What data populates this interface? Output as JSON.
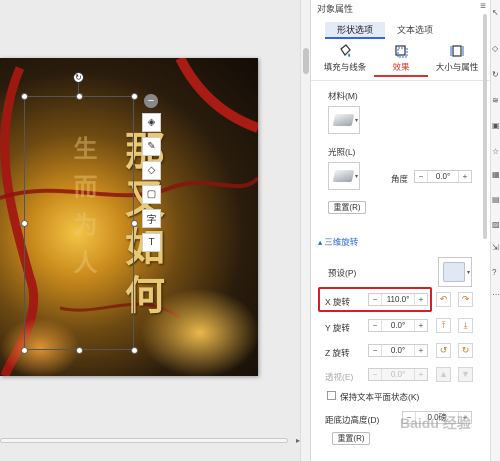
{
  "canvas": {
    "poem_left": "生而为人",
    "poem_right": "那又如何",
    "float_toolbar": [
      {
        "name": "collapse-icon",
        "glyph": "−"
      },
      {
        "name": "layers-icon",
        "glyph": "◈"
      },
      {
        "name": "pen-icon",
        "glyph": "✎"
      },
      {
        "name": "eraser-icon",
        "glyph": "◇"
      },
      {
        "name": "border-icon",
        "glyph": "▢"
      },
      {
        "name": "text-icon",
        "glyph": "字"
      },
      {
        "name": "textbox-icon",
        "glyph": "T"
      }
    ]
  },
  "panel": {
    "title": "对象属性",
    "menu_glyph": "≡",
    "tabs": [
      "形状选项",
      "文本选项"
    ],
    "subtabs": [
      "填充与线条",
      "效果",
      "大小与属性"
    ],
    "material_label": "材料(M)",
    "lighting_label": "光照(L)",
    "angle_label": "角度",
    "angle_value": "0.0°",
    "reset_label": "重置(R)",
    "section_3d": "三维旋转",
    "preset_label": "预设(P)",
    "x_label": "X 旋转",
    "x_value": "110.0°",
    "y_label": "Y 旋转",
    "y_value": "0.0°",
    "z_label": "Z 旋转",
    "z_value": "0.0°",
    "persp_label": "透视(E)",
    "persp_value": "0.0°",
    "keep_flat_label": "保持文本平面状态(K)",
    "distance_label": "距底边高度(D)",
    "distance_value": "0.0磅",
    "reset2_label": "重置(R)"
  },
  "watermark": "Baidu 经验",
  "colors": {
    "accent_blue": "#2d6ad8",
    "accent_red": "#d8332a",
    "highlight": "#d42020",
    "rotate_orange": "#d8772a"
  }
}
